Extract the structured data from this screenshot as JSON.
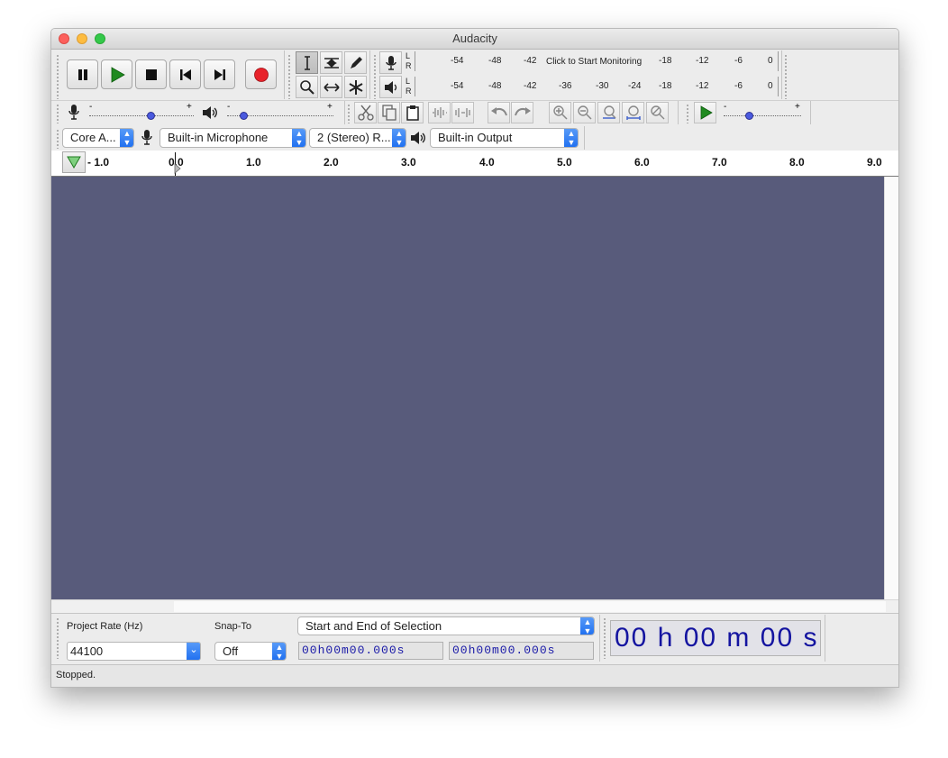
{
  "window": {
    "title": "Audacity",
    "close_color": "#fc605c",
    "minimize_color": "#fdbc40",
    "zoom_color": "#34c84a"
  },
  "meters": {
    "record_scale": [
      "-54",
      "-48",
      "-42",
      "-18",
      "-12",
      "-6",
      "0"
    ],
    "record_prompt": "Click to Start Monitoring",
    "playback_scale": [
      "-54",
      "-48",
      "-42",
      "-36",
      "-30",
      "-24",
      "-18",
      "-12",
      "-6",
      "0"
    ],
    "channel_l": "L",
    "channel_r": "R"
  },
  "mixer": {
    "minus": "-",
    "plus": "+"
  },
  "devices": {
    "host": "Core A...",
    "recording_device": "Built-in Microphone",
    "channels": "2 (Stereo) R...",
    "playback_device": "Built-in Output"
  },
  "ruler": {
    "labels": [
      "- 1.0",
      "0.0",
      "1.0",
      "2.0",
      "3.0",
      "4.0",
      "5.0",
      "6.0",
      "7.0",
      "8.0",
      "9.0"
    ]
  },
  "selection_bar": {
    "project_rate_label": "Project Rate (Hz)",
    "project_rate_value": "44100",
    "snap_to_label": "Snap-To",
    "snap_to_value": "Off",
    "selection_mode": "Start and End of Selection",
    "start_time": "00h00m00.000s",
    "end_time": "00h00m00.000s",
    "audio_position": "00 h 00 m 00 s"
  },
  "status": {
    "text": "Stopped."
  },
  "colors": {
    "track_area": "#585b7b",
    "record_red": "#e8222a",
    "play_green": "#1f8a1f",
    "time_digits": "#1414a0"
  }
}
